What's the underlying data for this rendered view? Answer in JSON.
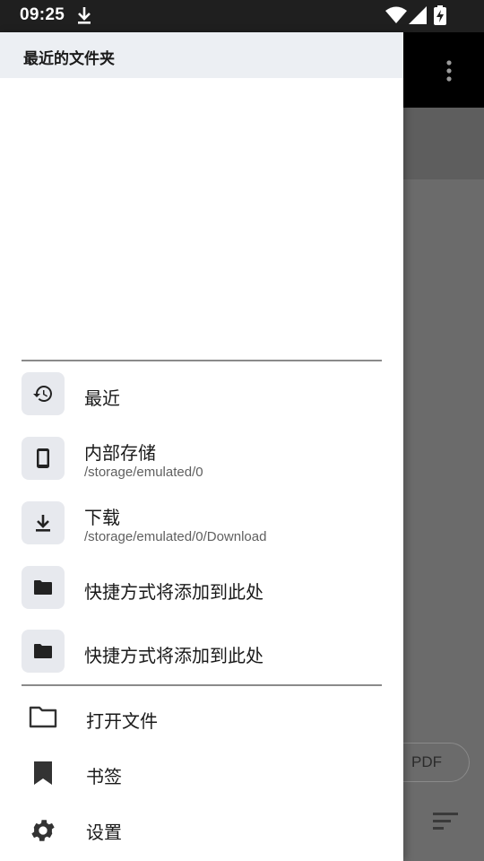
{
  "status_bar": {
    "time": "09:25",
    "icons": [
      "download-icon",
      "wifi-icon",
      "signal-icon",
      "battery-charging-icon"
    ]
  },
  "background_app": {
    "menu_icon": "more-vert-icon",
    "chip_label": "PDF",
    "sort_icon": "sort-icon"
  },
  "drawer": {
    "header_title": "最近的文件夹",
    "locations": [
      {
        "icon": "history-icon",
        "label": "最近",
        "subtitle": ""
      },
      {
        "icon": "phone-icon",
        "label": "内部存储",
        "subtitle": "/storage/emulated/0"
      },
      {
        "icon": "download-icon",
        "label": "下载",
        "subtitle": "/storage/emulated/0/Download"
      },
      {
        "icon": "folder-icon",
        "label": "快捷方式将添加到此处",
        "subtitle": ""
      },
      {
        "icon": "folder-icon",
        "label": "快捷方式将添加到此处",
        "subtitle": ""
      }
    ],
    "menu": [
      {
        "icon": "folder-outline-icon",
        "label": "打开文件"
      },
      {
        "icon": "bookmark-icon",
        "label": "书签"
      },
      {
        "icon": "gear-icon",
        "label": "设置"
      }
    ]
  },
  "colors": {
    "drawer_header_bg": "#eceff3",
    "icon_box_bg": "#e7e9ee",
    "scrim": "#6b6b6b",
    "status_bar": "#1f1f1f"
  }
}
